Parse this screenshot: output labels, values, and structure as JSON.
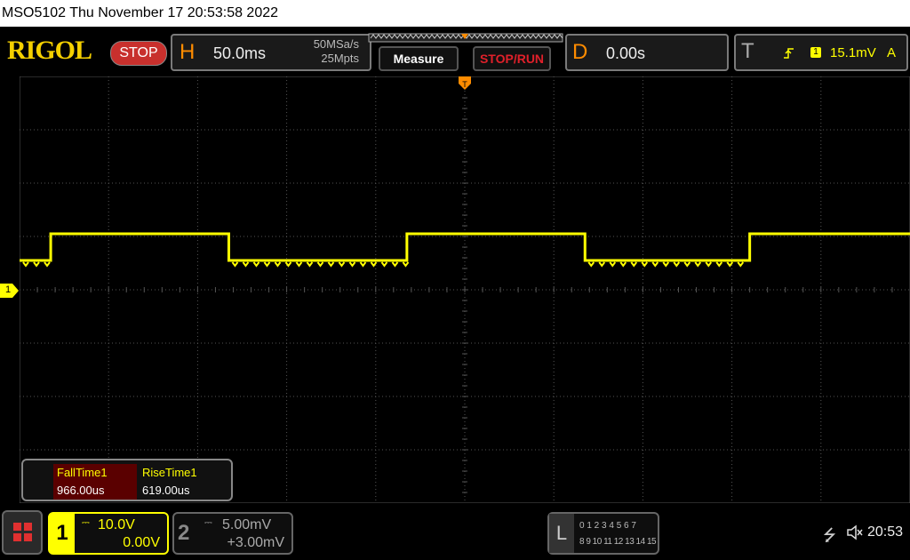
{
  "title_bar": {
    "text": "MSO5102  Thu November 17 20:53:58 2022"
  },
  "logo": "RIGOL",
  "run_state": "STOP",
  "horizontal": {
    "letter": "H",
    "timebase": "50.0ms",
    "sample_rate": "50MSa/s",
    "depth": "25Mpts"
  },
  "buttons": {
    "measure": "Measure",
    "stop_run": "STOP/RUN"
  },
  "delay": {
    "letter": "D",
    "value": "0.00s"
  },
  "trigger": {
    "letter": "T",
    "channel": "1",
    "level": "15.1mV",
    "mode": "A"
  },
  "channel1_marker": "1",
  "measurements": [
    {
      "name": "FallTime1",
      "value": "966.00us"
    },
    {
      "name": "RiseTime1",
      "value": "619.00us"
    }
  ],
  "channels": [
    {
      "num": "1",
      "scale": "10.0V",
      "offset": "0.00V"
    },
    {
      "num": "2",
      "scale": "5.00mV",
      "offset": "+3.00mV"
    }
  ],
  "logic": {
    "letter": "L",
    "row1": "0 1 2 3  4 5 6 7",
    "row2": "8 9 10 11 12 13 14 15"
  },
  "status": {
    "time": "20:53"
  },
  "colors": {
    "ch1": "#ffff00",
    "accent": "#ff8c00",
    "stop": "#c8302d",
    "grid": "#555555"
  },
  "waveform": {
    "high_level_div": 1.05,
    "low_level_div": 0.55,
    "transitions_div": [
      0.35,
      2.35,
      4.35,
      6.35,
      8.2
    ]
  }
}
